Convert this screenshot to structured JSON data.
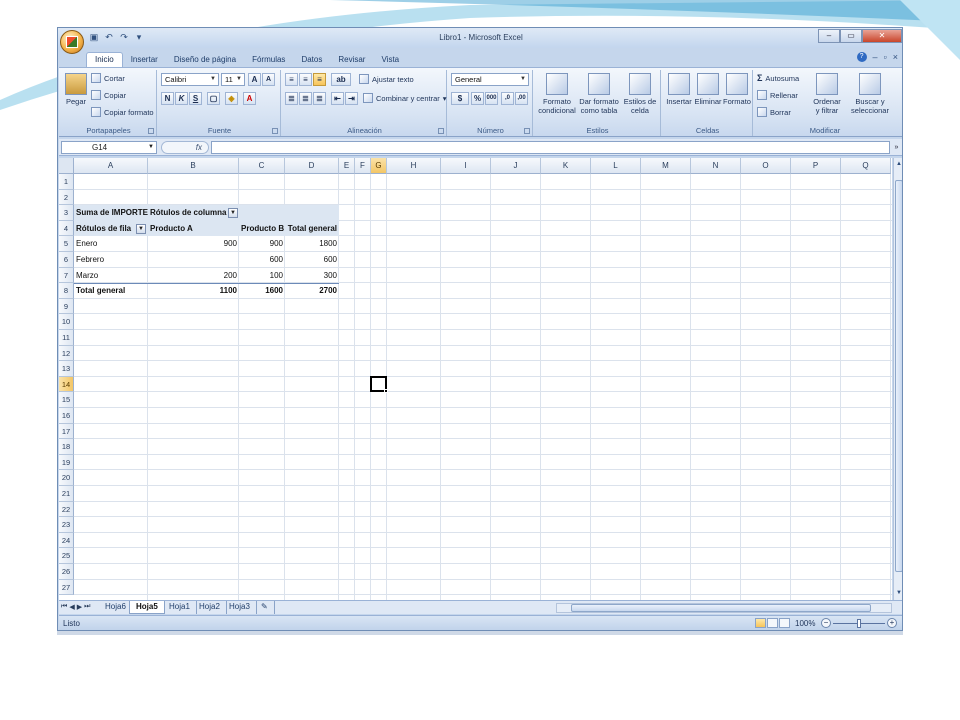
{
  "window": {
    "title": "Libro1 - Microsoft Excel"
  },
  "tabs": [
    "Inicio",
    "Insertar",
    "Diseño de página",
    "Fórmulas",
    "Datos",
    "Revisar",
    "Vista"
  ],
  "ribbon": {
    "clipboard": {
      "label": "Portapapeles",
      "paste": "Pegar",
      "cut": "Cortar",
      "copy": "Copiar",
      "format_painter": "Copiar formato"
    },
    "font": {
      "label": "Fuente",
      "name": "Calibri",
      "size": "11"
    },
    "alignment": {
      "label": "Alineación",
      "wrap": "Ajustar texto",
      "merge": "Combinar y centrar"
    },
    "number": {
      "label": "Número",
      "format": "General"
    },
    "styles": {
      "label": "Estilos",
      "cond1": "Formato",
      "cond2": "condicional",
      "table1": "Dar formato",
      "table2": "como tabla",
      "cell1": "Estilos de",
      "cell2": "celda"
    },
    "cells": {
      "label": "Celdas",
      "insert": "Insertar",
      "delete": "Eliminar",
      "format": "Formato"
    },
    "editing": {
      "label": "Modificar",
      "autosum": "Autosuma",
      "fill": "Rellenar",
      "clear": "Borrar",
      "sort1": "Ordenar",
      "sort2": "y filtrar",
      "find1": "Buscar y",
      "find2": "seleccionar"
    }
  },
  "formula_bar": {
    "name_box": "G14",
    "fx": "fx",
    "value": ""
  },
  "grid": {
    "columns": [
      "A",
      "B",
      "C",
      "D",
      "E",
      "F",
      "G",
      "H",
      "I",
      "J",
      "K",
      "L",
      "M",
      "N",
      "O",
      "P",
      "Q"
    ],
    "selected_column": "G",
    "selected_row": 14,
    "rows": [
      "1",
      "2",
      "3",
      "4",
      "5",
      "6",
      "7",
      "8",
      "9",
      "10",
      "11",
      "12",
      "13",
      "14",
      "15",
      "16",
      "17",
      "18",
      "19",
      "20",
      "21",
      "22",
      "23",
      "24",
      "25",
      "26",
      "27"
    ]
  },
  "pivot": {
    "value_field": "Suma de IMPORTE",
    "col_labels": "Rótulos de columna",
    "row_labels": "Rótulos de fila",
    "col_a": "Producto A",
    "col_b": "Producto B",
    "col_total": "Total general",
    "r1": {
      "label": "Enero",
      "a": "900",
      "b": "900",
      "t": "1800"
    },
    "r2": {
      "label": "Febrero",
      "a": "",
      "b": "600",
      "t": "600"
    },
    "r3": {
      "label": "Marzo",
      "a": "200",
      "b": "100",
      "t": "300"
    },
    "r4": {
      "label": "Total general",
      "a": "1100",
      "b": "1600",
      "t": "2700"
    }
  },
  "sheets": [
    "Hoja6",
    "Hoja5",
    "Hoja1",
    "Hoja2",
    "Hoja3"
  ],
  "active_sheet": "Hoja5",
  "status": {
    "text": "Listo",
    "zoom": "100%"
  }
}
